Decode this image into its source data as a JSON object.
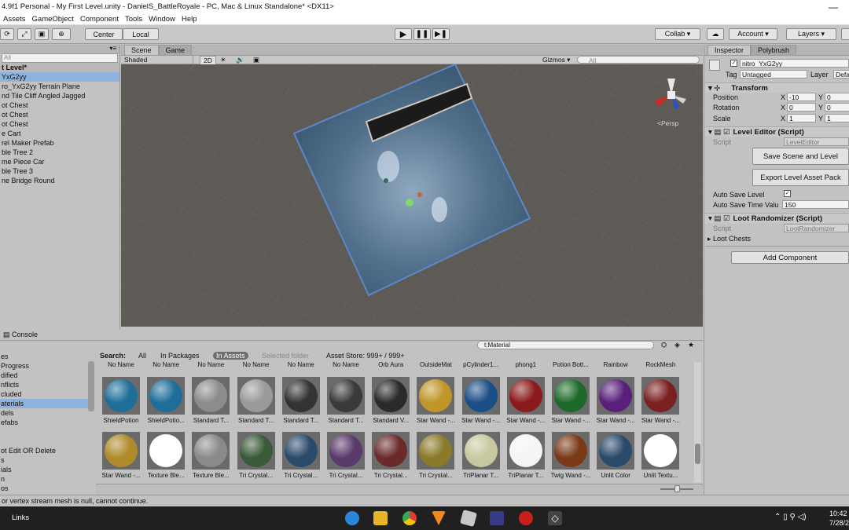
{
  "window": {
    "title": "4.9f1 Personal - My First Level.unity - DanielS_BattleRoyale - PC, Mac & Linux Standalone* <DX11>",
    "minimize": "—"
  },
  "menu": [
    "Assets",
    "GameObject",
    "Component",
    "Tools",
    "Window",
    "Help"
  ],
  "toolbar": {
    "center": "Center",
    "local": "Local",
    "collab": "Collab ▾",
    "account": "Account ▾",
    "layers": "Layers ▾"
  },
  "hierarchy": {
    "search": "All",
    "root": "t Level*",
    "items": [
      {
        "label": "YxG2yy",
        "selected": true
      },
      {
        "label": "ro_YxG2yy Terrain Plane"
      },
      {
        "label": "nd Tile Cliff Angled Jagged"
      },
      {
        "label": "ot Chest"
      },
      {
        "label": "ot Chest"
      },
      {
        "label": "ot Chest"
      },
      {
        "label": "e Cart"
      },
      {
        "label": "rel Maker Prefab"
      },
      {
        "label": "ble Tree 2"
      },
      {
        "label": "me Piece Car"
      },
      {
        "label": "ble Tree 3"
      },
      {
        "label": "ne Bridge Round"
      }
    ]
  },
  "scene": {
    "tabs": [
      "Scene",
      "Game"
    ],
    "shading": "Shaded",
    "mode2d": "2D",
    "gizmos": "Gizmos ▾",
    "search": "All",
    "persp": "<Persp"
  },
  "inspector": {
    "tabs": [
      "Inspector",
      "Polybrush"
    ],
    "object_name": "nitro_YxG2yy",
    "tag_label": "Tag",
    "tag": "Untagged",
    "layer_label": "Layer",
    "layer": "Defa",
    "transform": {
      "title": "Transform",
      "rows": [
        {
          "label": "Position",
          "x": "-10",
          "y": "0"
        },
        {
          "label": "Rotation",
          "x": "0",
          "y": "0"
        },
        {
          "label": "Scale",
          "x": "1",
          "y": "1"
        }
      ]
    },
    "level_editor": {
      "title": "Level Editor (Script)",
      "script_label": "Script",
      "script": "LevelEditor",
      "save": "Save Scene and Level",
      "export": "Export Level Asset Pack",
      "autosave_label": "Auto Save Level",
      "autosave_time_label": "Auto Save Time Valu",
      "autosave_time": "150"
    },
    "loot": {
      "title": "Loot Randomizer (Script)",
      "script_label": "Script",
      "script": "LootRandomizer",
      "chests": "Loot Chests"
    },
    "add_component": "Add Component"
  },
  "console": {
    "tab": "Console"
  },
  "project": {
    "search_value": "t:Material",
    "tree": [
      {
        "label": "es"
      },
      {
        "label": "Progress"
      },
      {
        "label": "dified"
      },
      {
        "label": "nflicts"
      },
      {
        "label": "cluded"
      },
      {
        "label": "aterials",
        "selected": true
      },
      {
        "label": "dels"
      },
      {
        "label": "efabs"
      },
      {
        "label": ""
      },
      {
        "label": ""
      },
      {
        "label": "ot Edit OR Delete"
      },
      {
        "label": "s"
      },
      {
        "label": "ials"
      },
      {
        "label": "n"
      },
      {
        "label": "os"
      }
    ],
    "filter": {
      "search": "Search:",
      "all": "All",
      "in_packages": "In Packages",
      "in_assets": "In Assets",
      "selected_folder": "Selected folder",
      "store": "Asset Store: 999+ / 999+"
    },
    "top_labels": [
      "No Name",
      "No Name",
      "No Name",
      "No Name",
      "No Name",
      "No Name",
      "Orb Aura",
      "OutsideMat",
      "pCylinder1...",
      "phong1",
      "Potion Bott...",
      "Rainbow",
      "RockMesh"
    ],
    "row1": [
      {
        "label": "ShieldPotion",
        "color": "#1f6e9a"
      },
      {
        "label": "ShieldPotio...",
        "color": "#1f6e9a"
      },
      {
        "label": "Standard T...",
        "color": "#8c8c8c"
      },
      {
        "label": "Standard T...",
        "color": "#9a9a9a"
      },
      {
        "label": "Standard T...",
        "color": "#333333"
      },
      {
        "label": "Standard T...",
        "color": "#3a3a3a"
      },
      {
        "label": "Standard V...",
        "color": "#2a2a2a"
      },
      {
        "label": "Star Wand -...",
        "color": "#c0962a"
      },
      {
        "label": "Star Wand -...",
        "color": "#1b4e86"
      },
      {
        "label": "Star Wand -...",
        "color": "#8b1a1a"
      },
      {
        "label": "Star Wand -...",
        "color": "#1c6a2a"
      },
      {
        "label": "Star Wand -...",
        "color": "#5a1f7a"
      },
      {
        "label": "Star Wand -...",
        "color": "#7a2020"
      }
    ],
    "row2": [
      {
        "label": "Star Wand -...",
        "color": "#b08a2a"
      },
      {
        "label": "Texture Ble...",
        "color": "#ffffff"
      },
      {
        "label": "Texture Ble...",
        "color": "#8a8a8a"
      },
      {
        "label": "Tri Crystal...",
        "color": "#3a5a3a"
      },
      {
        "label": "Tri Crystal...",
        "color": "#2a4a6a"
      },
      {
        "label": "Tri Crystal...",
        "color": "#5a3a6a"
      },
      {
        "label": "Tri Crystal...",
        "color": "#6a2a2a"
      },
      {
        "label": "Tri Crystal...",
        "color": "#8a7a2a"
      },
      {
        "label": "TriPlanar T...",
        "color": "#c8c8a0"
      },
      {
        "label": "TriPlanar T...",
        "color": "#f5f5f5"
      },
      {
        "label": "Twig Wand -...",
        "color": "#7a3a18"
      },
      {
        "label": "Unlit Color",
        "color": "#2a4a6a"
      },
      {
        "label": "Unlit Textu...",
        "color": "#ffffff"
      }
    ]
  },
  "status": {
    "text": "or vertex stream mesh is null, cannot continue."
  },
  "taskbar": {
    "links": "Links",
    "time": "10:42",
    "date": "7/28/2"
  }
}
